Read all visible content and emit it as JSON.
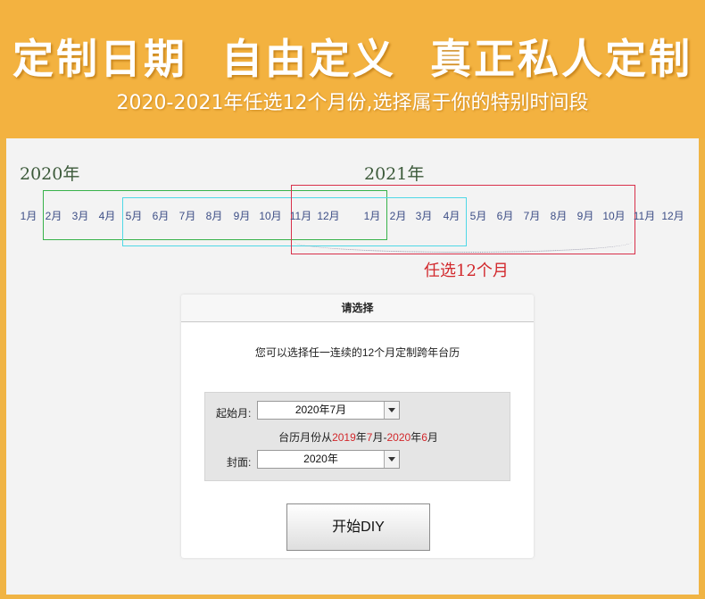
{
  "banner": {
    "title": "定制日期  自由定义  真正私人定制",
    "subtitle": "2020-2021年任选12个月份,选择属于你的特别时间段"
  },
  "timeline": {
    "year1": "2020年",
    "year2": "2021年",
    "months": [
      "1月",
      "2月",
      "3月",
      "4月",
      "5月",
      "6月",
      "7月",
      "8月",
      "9月",
      "10月",
      "11月",
      "12月",
      "1月",
      "2月",
      "3月",
      "4月",
      "5月",
      "6月",
      "7月",
      "8月",
      "9月",
      "10月",
      "11月",
      "12月"
    ],
    "range_note": "任选12个月"
  },
  "dialog": {
    "title": "请选择",
    "description": "您可以选择任一连续的12个月定制跨年台历",
    "start_month_label": "起始月:",
    "start_month_value": "2020年7月",
    "range_prefix": "台历月份从",
    "range_from_year": "2019",
    "range_year_char": "年",
    "range_from_month": "7",
    "range_month_char": "月",
    "range_dash": "-",
    "range_to_year": "2020",
    "range_year_char2": "年",
    "range_to_month": "6",
    "range_month_char2": "月",
    "cover_label": "封面:",
    "cover_value": "2020年",
    "start_button": "开始DIY"
  },
  "colors": {
    "banner_orange": "#f3b240",
    "range_green": "#37b24a",
    "range_cyan": "#4fd8e6",
    "range_red": "#d8304a",
    "accent_red": "#d2282c"
  }
}
